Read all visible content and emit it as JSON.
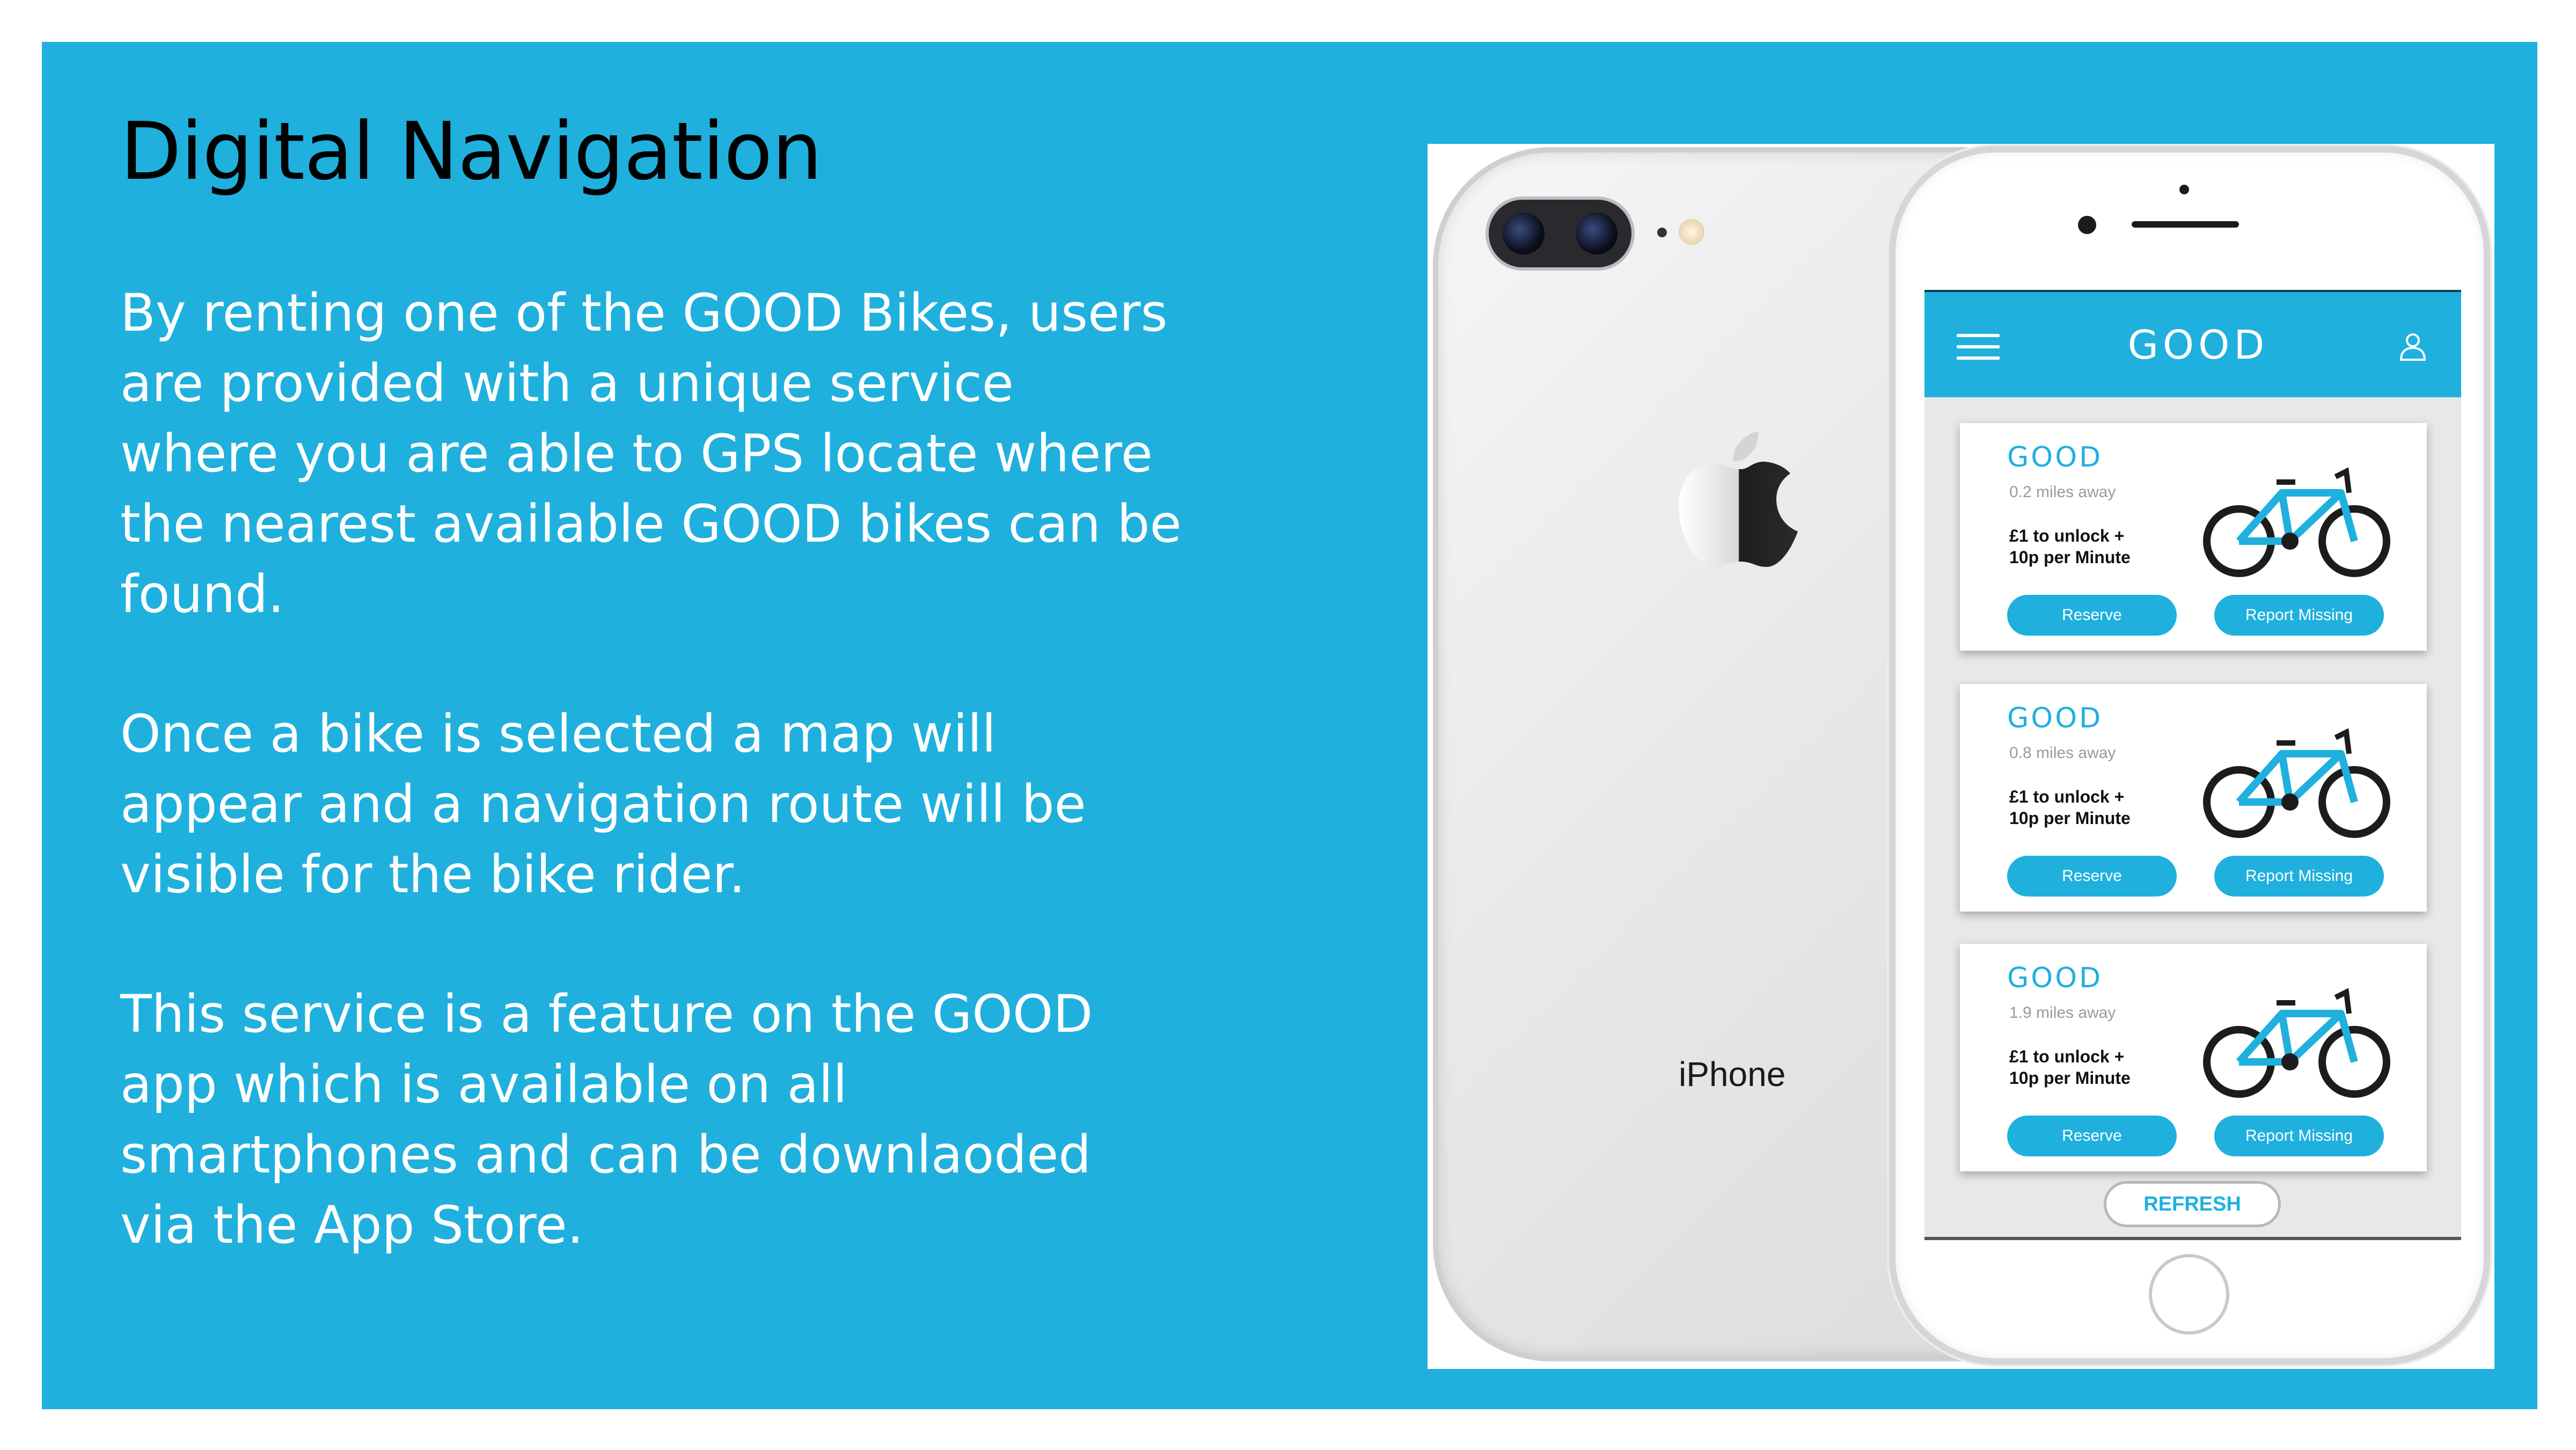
{
  "slide": {
    "title": "Digital Navigation",
    "paragraph_1": "By renting one of the GOOD Bikes, users are provided with a unique service where you are able to GPS locate where the nearest available GOOD bikes can be found.",
    "paragraph_2": "Once a bike is selected a map will appear and a navigation route will be visible for the bike rider.",
    "paragraph_3": "This service is a feature on the GOOD app which is available on all smartphones and can be downlaoded via the App Store.",
    "background_color": "#1fb0de"
  },
  "phone": {
    "back_label": "iPhone",
    "icons": [
      "apple-logo-icon",
      "camera-icon",
      "home-button"
    ]
  },
  "app": {
    "brand": "GOOD",
    "accent_color": "#1fb0de",
    "header_icons": [
      "menu-icon",
      "user-icon"
    ],
    "cards": [
      {
        "logo": "GOOD",
        "distance": "0.2 miles away",
        "price_line_1": "£1 to unlock +",
        "price_line_2": "10p per Minute",
        "reserve_label": "Reserve",
        "report_label": "Report Missing"
      },
      {
        "logo": "GOOD",
        "distance": "0.8 miles away",
        "price_line_1": "£1 to unlock +",
        "price_line_2": "10p per Minute",
        "reserve_label": "Reserve",
        "report_label": "Report Missing"
      },
      {
        "logo": "GOOD",
        "distance": "1.9 miles away",
        "price_line_1": "£1 to unlock +",
        "price_line_2": "10p per Minute",
        "reserve_label": "Reserve",
        "report_label": "Report Missing"
      }
    ],
    "refresh_label": "REFRESH"
  }
}
